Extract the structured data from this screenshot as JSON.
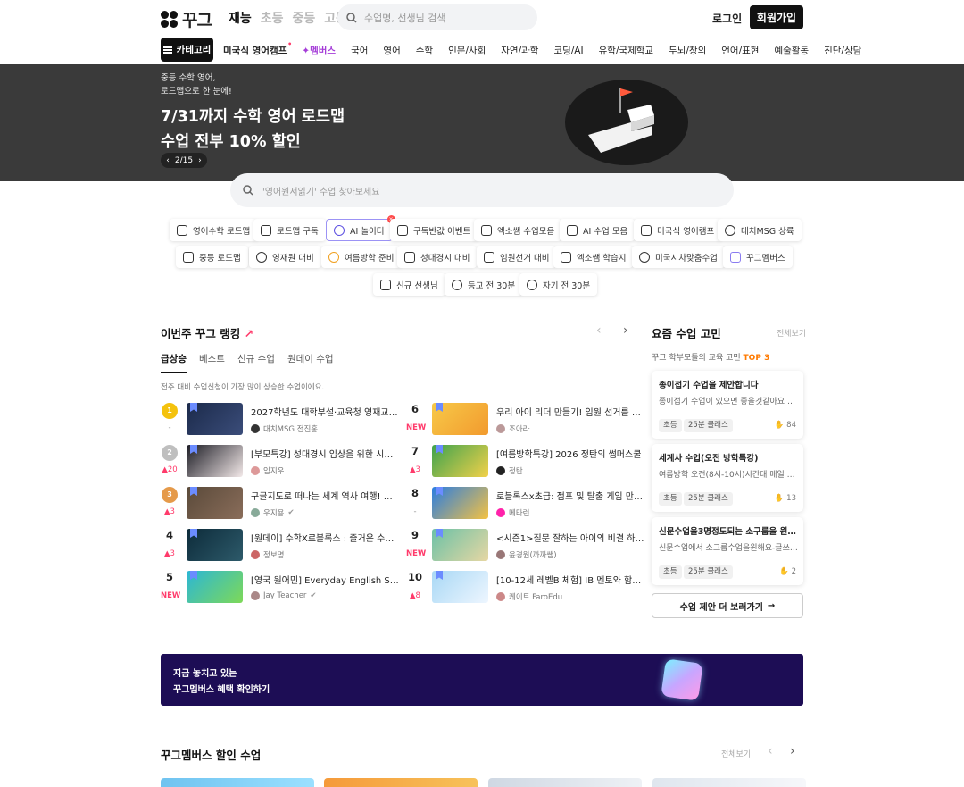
{
  "header": {
    "logo": "꾸그",
    "grades": [
      "재능",
      "초등",
      "중등",
      "고등"
    ],
    "search_placeholder": "수업명, 선생님 검색",
    "login": "로그인",
    "signup": "회원가입"
  },
  "nav": {
    "category": "카테고리",
    "items": [
      "미국식 영어캠프",
      "멤버스",
      "국어",
      "영어",
      "수학",
      "인문/사회",
      "자연/과학",
      "코딩/AI",
      "유학/국제학교",
      "두뇌/창의",
      "언어/표현",
      "예술활동",
      "진단/상담"
    ]
  },
  "hero": {
    "sub1": "중등 수학 영어,",
    "sub2": "로드맵으로 한 눈에!",
    "title1": "7/31까지 수학 영어 로드맵",
    "title2": "수업 전부 10% 할인",
    "pager": "2/15"
  },
  "search": {
    "placeholder": "'영어원서읽기' 수업 찾아보세요"
  },
  "chips": {
    "row1": [
      "영어수학 로드맵",
      "로드맵 구독",
      "AI 놀이터",
      "구독반값 이벤트",
      "엑소쌤 수업모음",
      "AI 수업 모음",
      "미국식 영어캠프",
      "대치MSG 상륙"
    ],
    "row2": [
      "중등 로드맵",
      "영재원 대비",
      "여름방학 준비",
      "성대경시 대비",
      "임원선거 대비",
      "엑소쌤 학습지",
      "미국시차맞춤수업",
      "꾸그멤버스"
    ],
    "row3": [
      "신규 선생님",
      "등교 전 30분",
      "자기 전 30분"
    ]
  },
  "ranking": {
    "title": "이번주 꾸그 랭킹",
    "tabs": [
      "급상승",
      "베스트",
      "신규 수업",
      "원데이 수업"
    ],
    "note": "전주 대비 수업신청이 가장 많이 상승한 수업이에요.",
    "left": [
      {
        "rank": "1",
        "delta": "-",
        "title": "2027학년도 대학부설·교육청 영재교육원 ...",
        "author": "대치MSG 전진홍"
      },
      {
        "rank": "2",
        "delta": "▲20",
        "title": "[부모특강] 성대경시 입상을 위한 시기별 학...",
        "author": "임지우"
      },
      {
        "rank": "3",
        "delta": "▲3",
        "title": "구글지도로 떠나는 세계 역사 여행! 세계 곳...",
        "author": "우지용"
      },
      {
        "rank": "4",
        "delta": "▲3",
        "title": "[원데이] 수학X로블록스 : 즐거운 수학공부...",
        "author": "정보명"
      },
      {
        "rank": "5",
        "delta": "NEW",
        "title": "[영국 원어민] Everyday English Summ...",
        "author": "Jay Teacher"
      }
    ],
    "right": [
      {
        "rank": "6",
        "delta": "NEW",
        "title": "우리 아이 리더 만들기! 임원 선거를 위한 말...",
        "author": "조아라"
      },
      {
        "rank": "7",
        "delta": "▲3",
        "title": "[여름방학특강] 2026 정탄의 썸머스쿨",
        "author": "정탄"
      },
      {
        "rank": "8",
        "delta": "-",
        "title": "로블록스x초급: 점프 및 탈출 게임 만들기",
        "author": "메타런"
      },
      {
        "rank": "9",
        "delta": "NEW",
        "title": "<시즌1>질문 잘하는 아이의 비결 하브루타...",
        "author": "윤경원(까까쌤)"
      },
      {
        "rank": "10",
        "delta": "▲8",
        "title": "[10-12세 레벨B 체험] IB 멘토와 함께 20...",
        "author": "케이트 FaroEdu"
      }
    ]
  },
  "requests": {
    "title": "요즘 수업 고민",
    "all": "전체보기",
    "sub": "꾸그 학부모들의 교육 고민",
    "top": "TOP 3",
    "cards": [
      {
        "title": "종이접기 수업을 제안합니다",
        "desc": "종이접기 수업이 있으면 좋을것같아요 난이...",
        "tag1": "초등",
        "tag2": "25분 클래스",
        "count": "84"
      },
      {
        "title": "세계사 수업(오전 방학특강)",
        "desc": "여름방학 오전(8시-10시)시간대 매일 또는 ...",
        "tag1": "초등",
        "tag2": "25분 클래스",
        "count": "13"
      },
      {
        "title": "신문수업을3명정도되는 소구룹을 원해요",
        "desc": "신문수업에서 소그룹수업을원해요-글쓰기와...",
        "tag1": "초등",
        "tag2": "25분 클래스",
        "count": "2"
      }
    ],
    "more": "수업 제안 더 보러가기"
  },
  "banner": {
    "line1": "지금 놓치고 있는",
    "line2": "꾸그멤버스 혜택 확인하기"
  },
  "discount": {
    "title": "꾸그멤버스 할인 수업",
    "all": "전체보기"
  },
  "colors": {
    "primary": "#111111",
    "accent": "#ff3b6b",
    "member_purple": "#a53dd8",
    "banner": "#1d0d55",
    "top3": "#ff7a00"
  }
}
